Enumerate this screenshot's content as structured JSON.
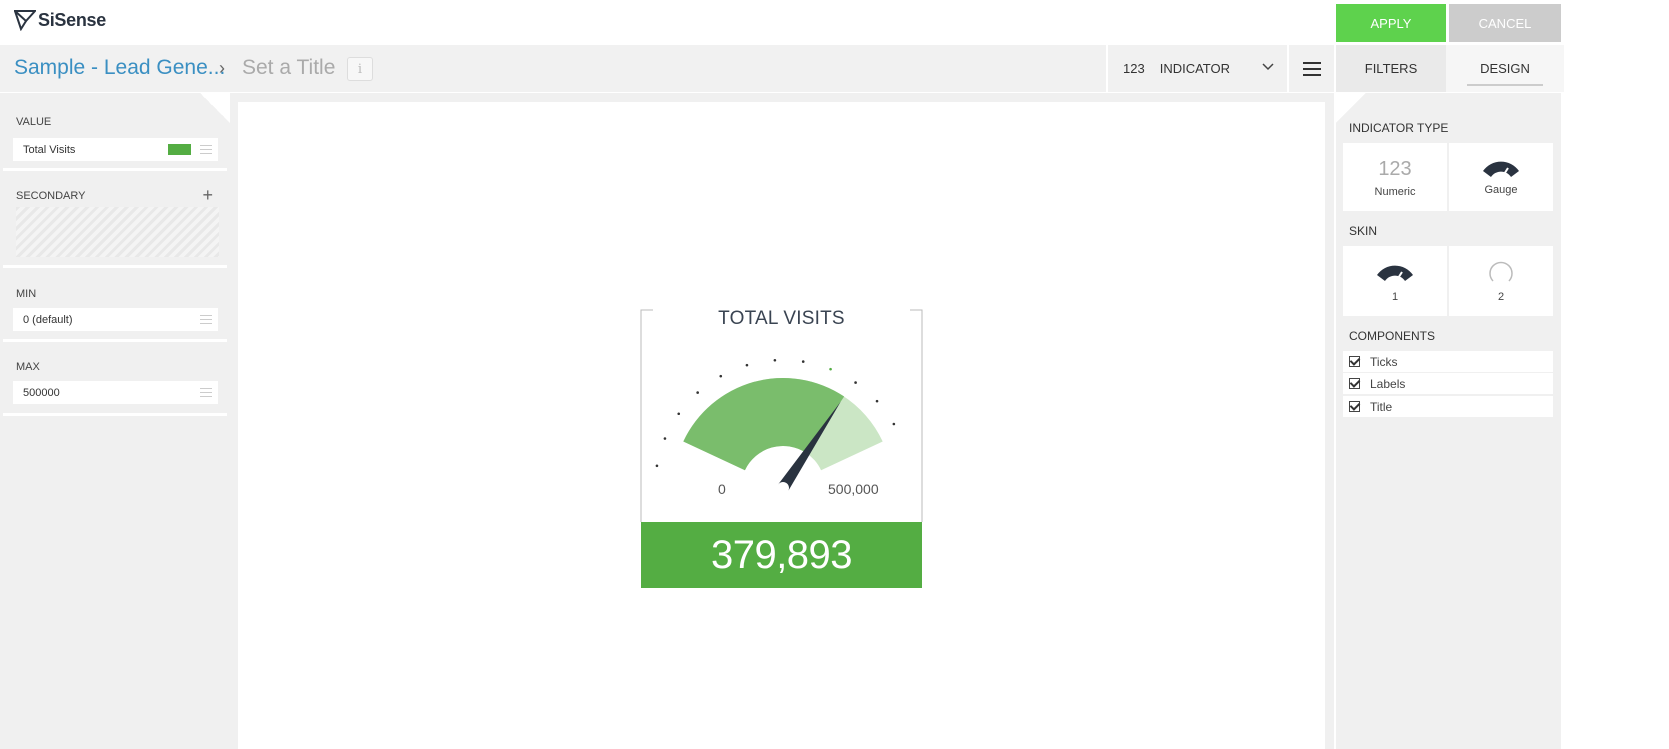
{
  "app": {
    "logo_text": "SiSense"
  },
  "actions": {
    "apply_label": "APPLY",
    "cancel_label": "CANCEL"
  },
  "breadcrumb": {
    "dashboard": "Sample - Lead Gene...",
    "separator": "›",
    "widget_title_placeholder": "Set a Title",
    "info_icon": "i"
  },
  "widget_type": {
    "icon_text": "123",
    "label": "INDICATOR"
  },
  "tabs": {
    "filters": "FILTERS",
    "design": "DESIGN",
    "active": "DESIGN"
  },
  "left_panel": {
    "value": {
      "label": "VALUE",
      "item": "Total Visits",
      "color": "#54ad43"
    },
    "secondary": {
      "label": "SECONDARY",
      "add_icon": "+"
    },
    "min": {
      "label": "MIN",
      "item": "0 (default)"
    },
    "max": {
      "label": "MAX",
      "item": "500000"
    }
  },
  "indicator": {
    "title": "TOTAL VISITS",
    "min_label": "0",
    "max_label": "500,000",
    "value_display": "379,893",
    "value": 379893,
    "min": 0,
    "max": 500000,
    "color": "#54ad43"
  },
  "right_panel": {
    "indicator_type": {
      "label": "INDICATOR TYPE",
      "options": [
        {
          "icon_text": "123",
          "label": "Numeric"
        },
        {
          "icon": "gauge-icon",
          "label": "Gauge"
        }
      ]
    },
    "skin": {
      "label": "SKIN",
      "options": [
        {
          "icon": "gauge-icon",
          "label": "1"
        },
        {
          "icon": "ring-icon",
          "label": "2"
        }
      ]
    },
    "components": {
      "label": "COMPONENTS",
      "items": [
        {
          "label": "Ticks",
          "checked": true
        },
        {
          "label": "Labels",
          "checked": true
        },
        {
          "label": "Title",
          "checked": true
        }
      ]
    }
  }
}
